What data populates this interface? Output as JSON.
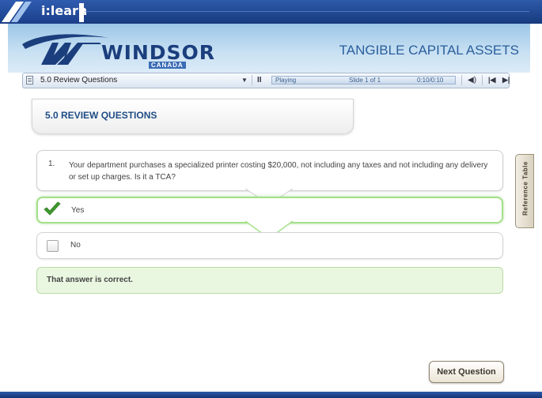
{
  "app": {
    "brand": "i:learn"
  },
  "header": {
    "logo_main": "WINDSOR",
    "logo_sub": "CANADA",
    "course_title": "TANGIBLE CAPITAL ASSETS"
  },
  "playbar": {
    "slide_title": "5.0 Review Questions",
    "pause_symbol": "II",
    "state": "Playing",
    "slide_info": "Slide 1 of 1",
    "time": "0:10/0:10",
    "progress": 1.0,
    "volume_symbol": "◀)",
    "prev_symbol": "|◀",
    "next_symbol": "▶|"
  },
  "main": {
    "section_title": "5.0 REVIEW QUESTIONS",
    "question": {
      "number": "1.",
      "text": "Your department purchases a specialized printer costing $20,000, not including any taxes and not including any delivery or set up charges.  Is it a TCA?"
    },
    "options": [
      {
        "label": "Yes",
        "selected": true
      },
      {
        "label": "No",
        "selected": false
      }
    ],
    "feedback": "That answer is correct.",
    "next_button": "Next Question"
  },
  "sidebar": {
    "reference_tab": "Reference Table"
  },
  "colors": {
    "accent_blue": "#1f4d86",
    "correct_green": "#a5e08b",
    "feedback_bg": "#e9f7e1"
  }
}
